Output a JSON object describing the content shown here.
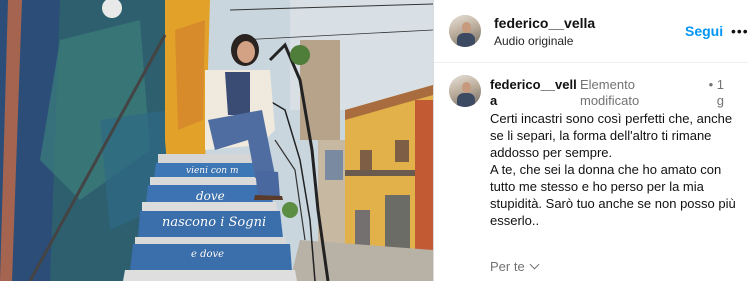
{
  "post": {
    "image_alt": "",
    "steps": [
      "vieni con m",
      "dove",
      "nascono i Sogni",
      "e dove"
    ]
  },
  "header": {
    "username": "federico__vella",
    "subtitle": "Audio originale",
    "follow_label": "Segui",
    "more_icon": "•••"
  },
  "comment": {
    "username_line1": "federico__vell",
    "username_line2": "a",
    "edited_label_1": "Elemento",
    "edited_label_2": "modificato",
    "time_dot": "•",
    "time": "1 g",
    "text_lines": [
      "Certi incastri sono così perfetti che, anche se li separi, la forma dell'altro ti rimane addosso per sempre.",
      "A te, che sei la donna che ho amato con tutto me stesso e ho perso per la mia stupidità. Sarò tuo anche se non posso più esserlo.."
    ]
  },
  "footer": {
    "for_you_label": "Per te"
  },
  "colors": {
    "accent": "#0095f6",
    "muted": "#737373",
    "wall_teal": "#2d5f6e",
    "wall_yellow": "#e2a22a",
    "steps_blue": "#3e77b6"
  }
}
